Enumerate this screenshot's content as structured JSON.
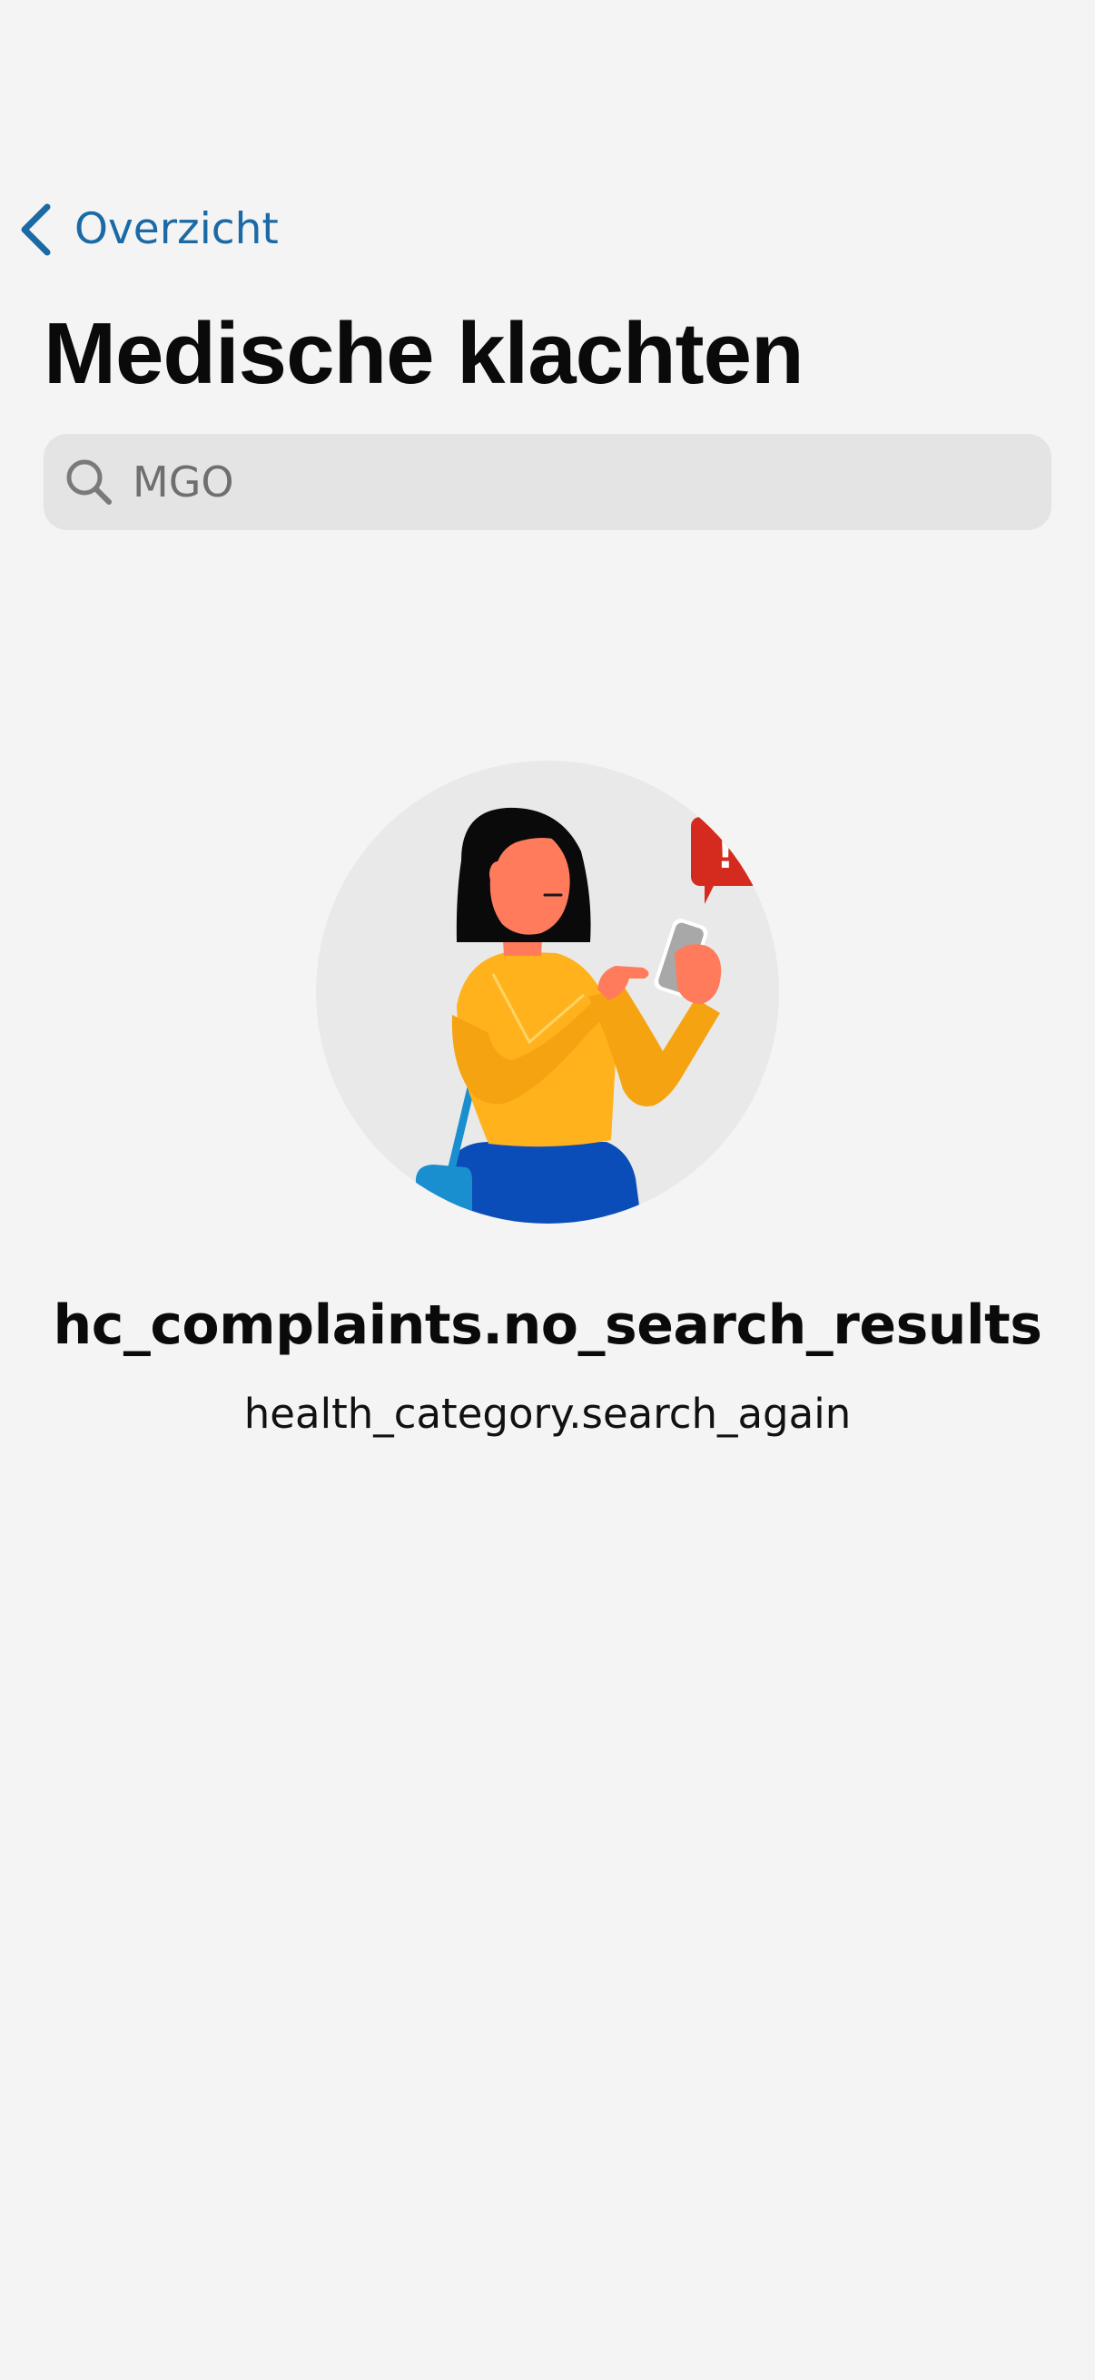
{
  "navigation": {
    "back_label": "Overzicht",
    "back_icon": "chevron-left-icon"
  },
  "header": {
    "title": "Medische klachten"
  },
  "search": {
    "value": "MGO",
    "icon": "search-icon"
  },
  "empty_state": {
    "illustration": "woman-with-phone-alert-illustration",
    "alert_glyph": "!",
    "title": "hc_complaints.no_search_results",
    "subtitle": "health_category.search_again"
  },
  "colors": {
    "background": "#f4f4f4",
    "accent": "#1c6aa5",
    "search_background": "#e4e4e4",
    "alert_red": "#d52b1e"
  }
}
